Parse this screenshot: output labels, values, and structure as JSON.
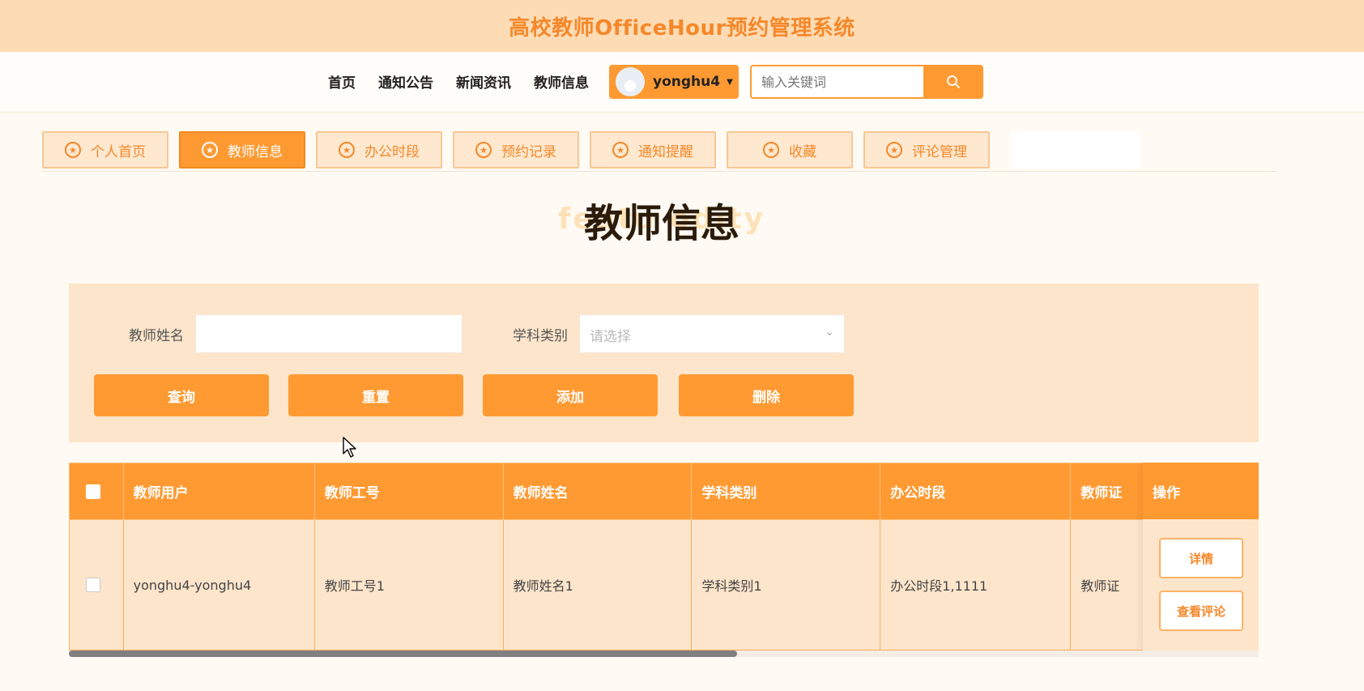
{
  "site": {
    "title": "高校教师OfficeHour预约管理系统"
  },
  "nav": {
    "links": [
      "首页",
      "通知公告",
      "新闻资讯",
      "教师信息"
    ],
    "user": {
      "name": "yonghu4"
    },
    "search": {
      "placeholder": "输入关键词"
    }
  },
  "tabs": [
    {
      "label": "个人首页",
      "active": false
    },
    {
      "label": "教师信息",
      "active": true
    },
    {
      "label": "办公时段",
      "active": false
    },
    {
      "label": "预约记录",
      "active": false
    },
    {
      "label": "通知提醒",
      "active": false
    },
    {
      "label": "收藏",
      "active": false
    },
    {
      "label": "评论管理",
      "active": false
    }
  ],
  "page": {
    "title": "教师信息",
    "title_bg": "featu        odity"
  },
  "filters": {
    "name_label": "教师姓名",
    "name_value": "",
    "category_label": "学科类别",
    "category_placeholder": "请选择"
  },
  "buttons": {
    "search": "查询",
    "reset": "重置",
    "add": "添加",
    "delete": "删除"
  },
  "table": {
    "columns": [
      "教师用户",
      "教师工号",
      "教师姓名",
      "学科类别",
      "办公时段",
      "教师证"
    ],
    "ops_header": "操作",
    "rows": [
      {
        "cells": [
          "yonghu4-yonghu4",
          "教师工号1",
          "教师姓名1",
          "学科类别1",
          "办公时段1,1111",
          "教师证"
        ]
      }
    ],
    "row_actions": [
      "详情",
      "查看评论"
    ]
  },
  "colors": {
    "accent": "#ff9a33",
    "panel": "#fde5cb",
    "header_bg": "#fddcb5"
  }
}
